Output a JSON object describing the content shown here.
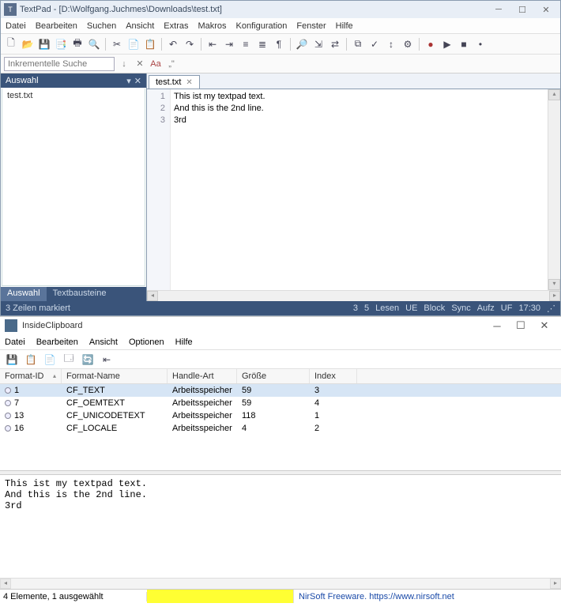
{
  "textpad": {
    "title": "TextPad - [D:\\Wolfgang.Juchmes\\Downloads\\test.txt]",
    "menus": [
      "Datei",
      "Bearbeiten",
      "Suchen",
      "Ansicht",
      "Extras",
      "Makros",
      "Konfiguration",
      "Fenster",
      "Hilfe"
    ],
    "search_placeholder": "Inkrementelle Suche",
    "side_header": "Auswahl",
    "side_items": [
      "test.txt"
    ],
    "side_tabs": [
      "Auswahl",
      "Textbausteine"
    ],
    "doc_tab": "test.txt",
    "lines": {
      "n1": "1",
      "n2": "2",
      "n3": "3",
      "l1": "This ist my textpad text.",
      "l2": "And this is the 2nd line.",
      "l3": "3rd"
    },
    "status_left": "3 Zeilen markiert",
    "status_cols": {
      "a": "3",
      "b": "5"
    },
    "status_flags": [
      "Lesen",
      "UE",
      "Block",
      "Sync",
      "Aufz",
      "UF"
    ],
    "status_time": "17:30"
  },
  "inside": {
    "title": "InsideClipboard",
    "menus": [
      "Datei",
      "Bearbeiten",
      "Ansicht",
      "Optionen",
      "Hilfe"
    ],
    "headers": {
      "h0": "Format-ID",
      "h1": "Format-Name",
      "h2": "Handle-Art",
      "h3": "Größe",
      "h4": "Index"
    },
    "rows": [
      {
        "id": "1",
        "name": "CF_TEXT",
        "handle": "Arbeitsspeicher",
        "size": "59",
        "index": "3",
        "sel": true
      },
      {
        "id": "7",
        "name": "CF_OEMTEXT",
        "handle": "Arbeitsspeicher",
        "size": "59",
        "index": "4",
        "sel": false
      },
      {
        "id": "13",
        "name": "CF_UNICODETEXT",
        "handle": "Arbeitsspeicher",
        "size": "118",
        "index": "1",
        "sel": false
      },
      {
        "id": "16",
        "name": "CF_LOCALE",
        "handle": "Arbeitsspeicher",
        "size": "4",
        "index": "2",
        "sel": false
      }
    ],
    "preview": "This ist my textpad text.\nAnd this is the 2nd line.\n3rd",
    "status_left": "4 Elemente, 1 ausgewählt",
    "status_right": "NirSoft Freeware. https://www.nirsoft.net"
  }
}
